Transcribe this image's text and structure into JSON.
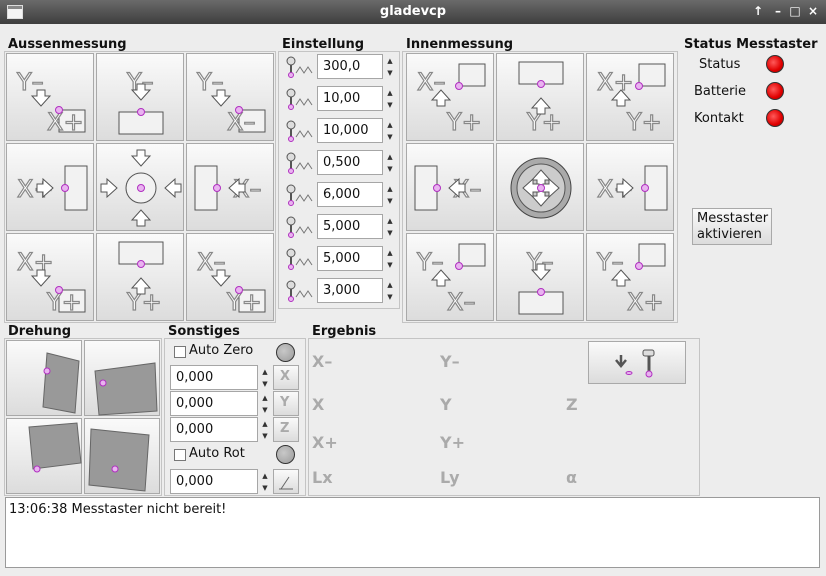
{
  "window": {
    "title": "gladevcp",
    "controls": [
      "↑",
      "–",
      "□",
      "×"
    ]
  },
  "aussen": {
    "title": "Aussenmessung",
    "buttons": [
      {
        "name": "outside-xplus-yminus-button",
        "labels": [
          "Y–",
          "X+"
        ]
      },
      {
        "name": "outside-yminus-button",
        "labels": [
          "Y–"
        ]
      },
      {
        "name": "outside-xminus-yminus-button",
        "labels": [
          "Y–",
          "X–"
        ]
      },
      {
        "name": "outside-xplus-button",
        "labels": [
          "X+"
        ]
      },
      {
        "name": "outside-center-button",
        "labels": []
      },
      {
        "name": "outside-xminus-button",
        "labels": [
          "X–"
        ]
      },
      {
        "name": "outside-xplus-yplus-button",
        "labels": [
          "X+",
          "Y+"
        ]
      },
      {
        "name": "outside-yplus-button",
        "labels": [
          "Y+"
        ]
      },
      {
        "name": "outside-xminus-yplus-button",
        "labels": [
          "X–",
          "Y+"
        ]
      }
    ]
  },
  "einstellung": {
    "title": "Einstellung",
    "values": [
      "300,0",
      "10,00",
      "10,000",
      "0,500",
      "6,000",
      "5,000",
      "5,000",
      "3,000"
    ]
  },
  "innen": {
    "title": "Innenmessung",
    "buttons": [
      {
        "name": "inside-xminus-yplus-button",
        "labels": [
          "X–",
          "Y+"
        ]
      },
      {
        "name": "inside-yplus-button",
        "labels": [
          "Y+"
        ]
      },
      {
        "name": "inside-xplus-yplus-button",
        "labels": [
          "X+",
          "Y+"
        ]
      },
      {
        "name": "inside-xminus-button",
        "labels": [
          "X–"
        ]
      },
      {
        "name": "inside-center-button",
        "labels": []
      },
      {
        "name": "inside-xplus-button",
        "labels": [
          "X+"
        ]
      },
      {
        "name": "inside-xminus-yminus-button",
        "labels": [
          "Y–",
          "X–"
        ]
      },
      {
        "name": "inside-yminus-button",
        "labels": [
          "Y–"
        ]
      },
      {
        "name": "inside-xplus-yminus-button",
        "labels": [
          "Y–",
          "X+"
        ]
      }
    ]
  },
  "status": {
    "title": "Status Messtaster",
    "items": [
      "Status",
      "Batterie",
      "Kontakt"
    ],
    "led_color": "#e00000",
    "activate_line1": "Messtaster",
    "activate_line2": "aktivieren"
  },
  "drehung": {
    "title": "Drehung"
  },
  "sonstiges": {
    "title": "Sonstiges",
    "auto_zero": "Auto Zero",
    "auto_rot": "Auto Rot",
    "values": [
      "0,000",
      "0,000",
      "0,000",
      "0,000"
    ],
    "axis_buttons": [
      "X",
      "Y",
      "Z"
    ]
  },
  "ergebnis": {
    "title": "Ergebnis",
    "col1": [
      "X–",
      "X",
      "X+",
      "Lx"
    ],
    "col2": [
      "Y–",
      "Y",
      "Y+",
      "Ly"
    ],
    "col3": [
      "Z",
      "",
      "α"
    ]
  },
  "log": {
    "text": "13:06:38  Messtaster nicht bereit!"
  }
}
